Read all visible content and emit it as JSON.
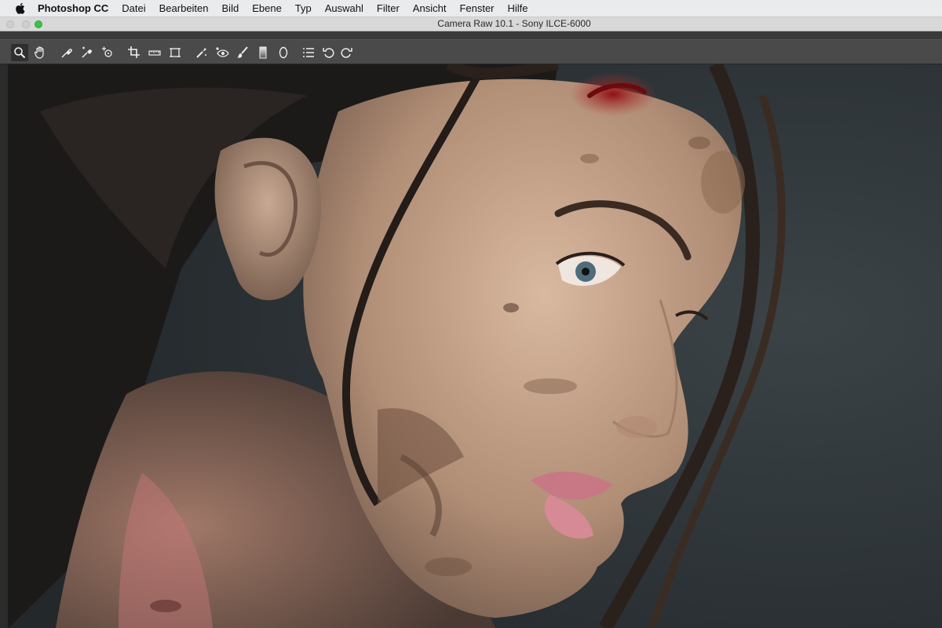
{
  "menubar": {
    "app_name": "Photoshop CC",
    "items": [
      "Datei",
      "Bearbeiten",
      "Bild",
      "Ebene",
      "Typ",
      "Auswahl",
      "Filter",
      "Ansicht",
      "Fenster",
      "Hilfe"
    ]
  },
  "window": {
    "title": "Camera Raw 10.1  -  Sony ILCE-6000"
  },
  "toolbar": {
    "tools": [
      "zoom-tool",
      "hand-tool",
      "white-balance-tool",
      "color-sampler-tool",
      "targeted-adjustment-tool",
      "crop-tool",
      "straighten-tool",
      "transform-tool",
      "spot-removal-tool",
      "red-eye-removal-tool",
      "adjustment-brush-tool",
      "graduated-filter-tool",
      "radial-filter-tool",
      "presets-list",
      "rotate-left-tool",
      "rotate-right-tool"
    ],
    "active_tool": "zoom-tool"
  },
  "canvas": {
    "image": "portrait photo of a woman in profile with dirt smudges and a forehead wound",
    "background_color": "#2f3437"
  },
  "colors": {
    "menubar_bg": "#e9ebec",
    "toolbar_bg": "#4a4a4a",
    "maximize_button": "#39c24a"
  }
}
